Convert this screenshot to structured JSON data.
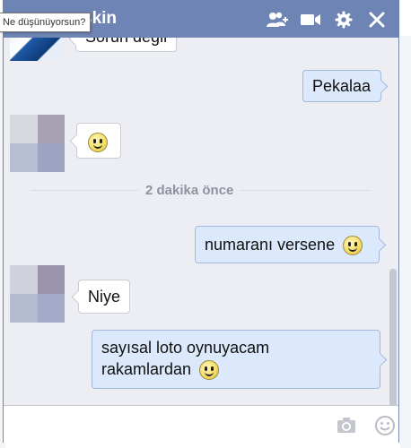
{
  "tooltip": "Ne düşünüyorsun?",
  "chat": {
    "title": "skin",
    "title_icons": [
      "add-friend-icon",
      "video-camera-icon",
      "gear-icon",
      "close-icon"
    ],
    "colors": {
      "titlebar": "#6d84b4",
      "outgoing": "#dce8fb",
      "incoming": "#ffffff",
      "panel": "#edeef3"
    }
  },
  "messages": {
    "top_partial": "Sorun değil",
    "m1": "Pekalaa",
    "m2_icon": "smiley-icon",
    "divider": "2 dakika önce",
    "m3": "numaranı versene",
    "m4": "Niye",
    "m5_line1": "sayısal loto oynuyacam",
    "m5_line2": "rakamlardan"
  },
  "composer": {
    "icons": [
      "camera-icon",
      "emoticon-icon"
    ]
  }
}
